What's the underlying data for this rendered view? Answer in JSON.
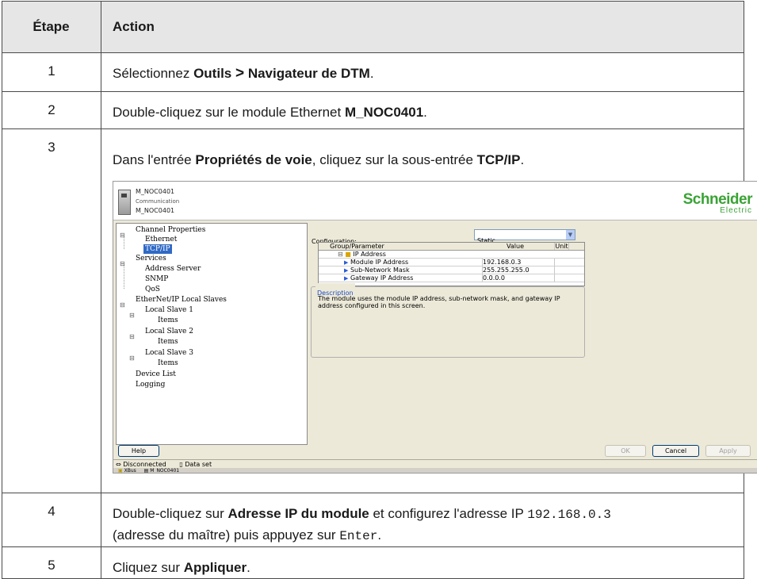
{
  "table": {
    "headers": [
      "Étape",
      "Action"
    ],
    "rows": [
      {
        "num": "1",
        "t1": "Sélectionnez ",
        "b1": "Outils",
        "t2": " ",
        "sym": ">",
        "t3": " ",
        "b2": "Navigateur de DTM",
        "t4": "."
      },
      {
        "num": "2",
        "t1": "Double-cliquez sur le module Ethernet ",
        "b1": "M_NOC0401",
        "t2": "."
      },
      {
        "num": "3",
        "t1": "Dans l'entrée ",
        "b1": "Propriétés de voie",
        "t2": ", cliquez sur la sous-entrée ",
        "b2": "TCP/IP",
        "t3": "."
      },
      {
        "num": "4",
        "t1": "Double-cliquez sur ",
        "b1": "Adresse IP du module",
        "t2": " et configurez l'adresse IP ",
        "code1": "192.168.0.3",
        "t3": "(adresse du maître) puis appuyez sur ",
        "code2": "Enter",
        "t4": "."
      },
      {
        "num": "5",
        "t1": "Cliquez sur ",
        "b1": "Appliquer",
        "t2": "."
      }
    ]
  },
  "screenshot": {
    "header": {
      "line1": "M_NOC0401",
      "line2": "Communication",
      "line3": "M_NOC0401",
      "logo_top": "Schneider",
      "logo_bottom": "Electric"
    },
    "tree": {
      "channel_properties": "Channel Properties",
      "ethernet": "Ethernet",
      "tcpip": "TCP/IP",
      "services": "Services",
      "address_server": "Address Server",
      "snmp": "SNMP",
      "qos": "QoS",
      "ethernetip_local_slaves": "EtherNet/IP Local Slaves",
      "local_slave_1": "Local Slave 1",
      "items_1": "Items",
      "local_slave_2": "Local Slave 2",
      "items_2": "Items",
      "local_slave_3": "Local Slave 3",
      "items_3": "Items",
      "device_list": "Device List",
      "logging": "Logging",
      "toggle": "⊟"
    },
    "panel": {
      "configuration_label": "Configuration:",
      "configuration_value": "Static",
      "grid_headers": {
        "group": "Group/Parameter",
        "value": "Value",
        "unit": "Unit"
      },
      "group_name": "IP Address",
      "params": [
        {
          "name": "Module IP Address",
          "value": "192.168.0.3"
        },
        {
          "name": "Sub-Network Mask",
          "value": "255.255.255.0"
        },
        {
          "name": "Gateway IP Address",
          "value": "0.0.0.0"
        }
      ],
      "description_title": "Description",
      "description_text": "The module uses the module IP address, sub-network mask, and gateway IP address configured in this screen."
    },
    "buttons": {
      "help": "Help",
      "ok": "OK",
      "cancel": "Cancel",
      "apply": "Apply"
    },
    "status": {
      "connection": "Disconnected",
      "dataset": "Data set"
    },
    "tabs": {
      "xbus": "XBus",
      "module": "M_NOC0401"
    }
  }
}
